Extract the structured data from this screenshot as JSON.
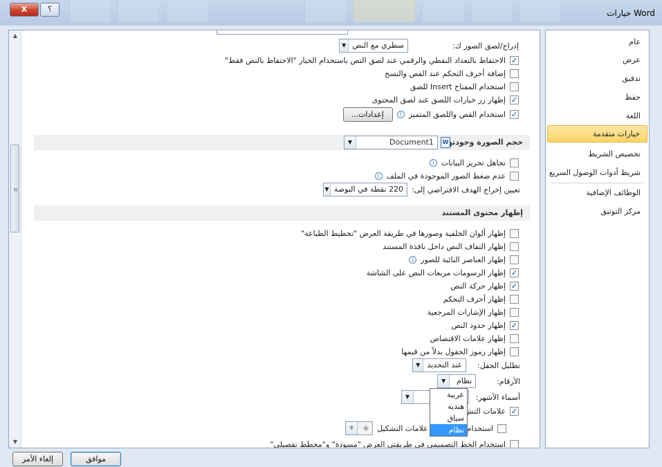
{
  "window": {
    "title": "خيارات Word",
    "close_label": "X",
    "help_label": "؟"
  },
  "nav": {
    "items": [
      {
        "label": "عام"
      },
      {
        "label": "عرض"
      },
      {
        "label": "تدقيق"
      },
      {
        "label": "حفظ"
      },
      {
        "label": "اللغة"
      },
      {
        "label": "خيارات متقدمة"
      },
      {
        "label": "تخصيص الشريط"
      },
      {
        "label": "شريط أدوات الوصول السريع"
      },
      {
        "label": "الوظائف الإضافية"
      },
      {
        "label": "مركز التوثيق"
      }
    ]
  },
  "paste": {
    "insert_picture_label": "إدراج/لصق الصور ك:",
    "insert_picture_value": "سطري مع النص",
    "opt_keep_bullets": "الاحتفاظ بالتعداد النقطي والرقمي عند لصق النص باستخدام الخيار \"الاحتفاظ بالنص فقط\"",
    "opt_add_control_chars": "إضافة أحرف التحكم عند القص والنسخ",
    "opt_insert_key": "استخدام المفتاح Insert للصق",
    "opt_show_paste_button": "إظهار زر خيارات اللصق عند لصق المحتوى",
    "opt_smart_cut": "استخدام القص واللصق المتميز",
    "settings_button": "إعدادات..."
  },
  "image_size": {
    "section_title": "حجم الصورة وجودتها",
    "document_value": "Document1",
    "opt_discard_edit_data": "تجاهل تحرير البيانات",
    "opt_no_compress": "عدم ضغط الصور الموجودة في الملف",
    "default_output_label": "تعيين إخراج الهدف الافتراضي إلى:",
    "default_output_value": "220 نقطة في البوصة"
  },
  "document_content": {
    "section_title": "إظهار محتوى المستند",
    "opt_bg_colors": "إظهار ألوان الخلفية وصورها في طريقة العرض \"تخطيط الطباعة\"",
    "opt_wrap_text": "إظهار التفاف النص داخل نافذة المستند",
    "opt_placeholders": "إظهار العناصر النائبة للصور",
    "opt_drawings": "إظهار الرسومات مربعات النص على الشاشة",
    "opt_text_animation": "إظهار حركة النص",
    "opt_control_chars": "إظهار أحرف التحكم",
    "opt_bookmarks": "إظهار الإشارات المرجعية",
    "opt_text_boundaries": "إظهار حدود النص",
    "opt_crop_marks": "إظهار علامات الاقتصاص",
    "opt_field_codes": "إظهار رموز الحقول بدلاً من قيمها",
    "field_shading_label": "تظليل الحقل:",
    "field_shading_value": "عند التحديد",
    "numerals_label": "الأرقام:",
    "numerals_value": "نظام",
    "month_names_label": "أسماء الأشهر:",
    "diacritics_label": "علامات التش",
    "use_diacritics_label": "استخدام",
    "diacritics_color_label": "علامات التشكيل",
    "last_row": "استخدام الخط التصميمي في طريقتي العرض \"مسودة\" و\"مخطط تفصيلي\""
  },
  "numerals_dropdown": {
    "options": [
      "عربية",
      "هندية",
      "سياق",
      "نظام"
    ],
    "selected": "نظام"
  },
  "footer": {
    "ok_label": "موافق",
    "cancel_label": "إلغاء الأمر"
  },
  "colors": {
    "accent_selected": "#fbd565",
    "dropdown_highlight": "#3399ff"
  }
}
